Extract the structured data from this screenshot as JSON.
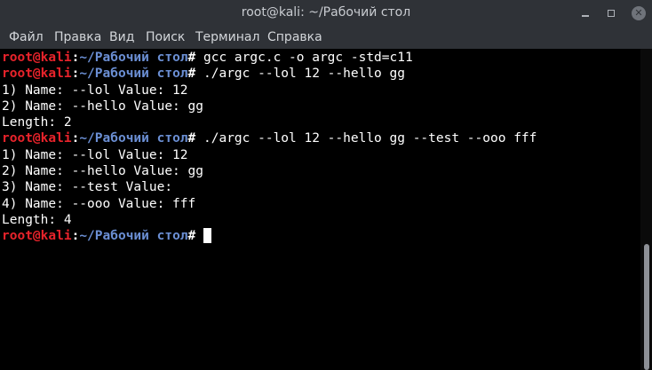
{
  "window": {
    "title": "root@kali: ~/Рабочий стол",
    "close_glyph": "✕"
  },
  "menu": {
    "file": "Файл",
    "edit": "Правка",
    "view": "Вид",
    "search": "Поиск",
    "terminal": "Терминал",
    "help": "Справка"
  },
  "prompt": {
    "user": "root@kali",
    "sep": ":",
    "path": "~/Рабочий стол",
    "hash": "# "
  },
  "lines": {
    "l1_cmd": "gcc argc.c -o argc -std=c11",
    "l2_cmd": "./argc --lol 12 --hello gg",
    "l3": "1) Name: --lol Value: 12",
    "l4": "2) Name: --hello Value: gg",
    "l5": "Length: 2",
    "l6_cmd": "./argc --lol 12 --hello gg --test --ooo fff",
    "l7": "1) Name: --lol Value: 12",
    "l8": "2) Name: --hello Value: gg",
    "l9": "3) Name: --test Value:",
    "l10": "4) Name: --ooo Value: fff",
    "l11": "Length: 4"
  },
  "colors": {
    "prompt_user": "#e8232b",
    "prompt_path": "#6b8fd4",
    "background": "#000000",
    "titlebar": "#2f3237"
  },
  "scroll": {
    "position_fraction": 1.0
  }
}
